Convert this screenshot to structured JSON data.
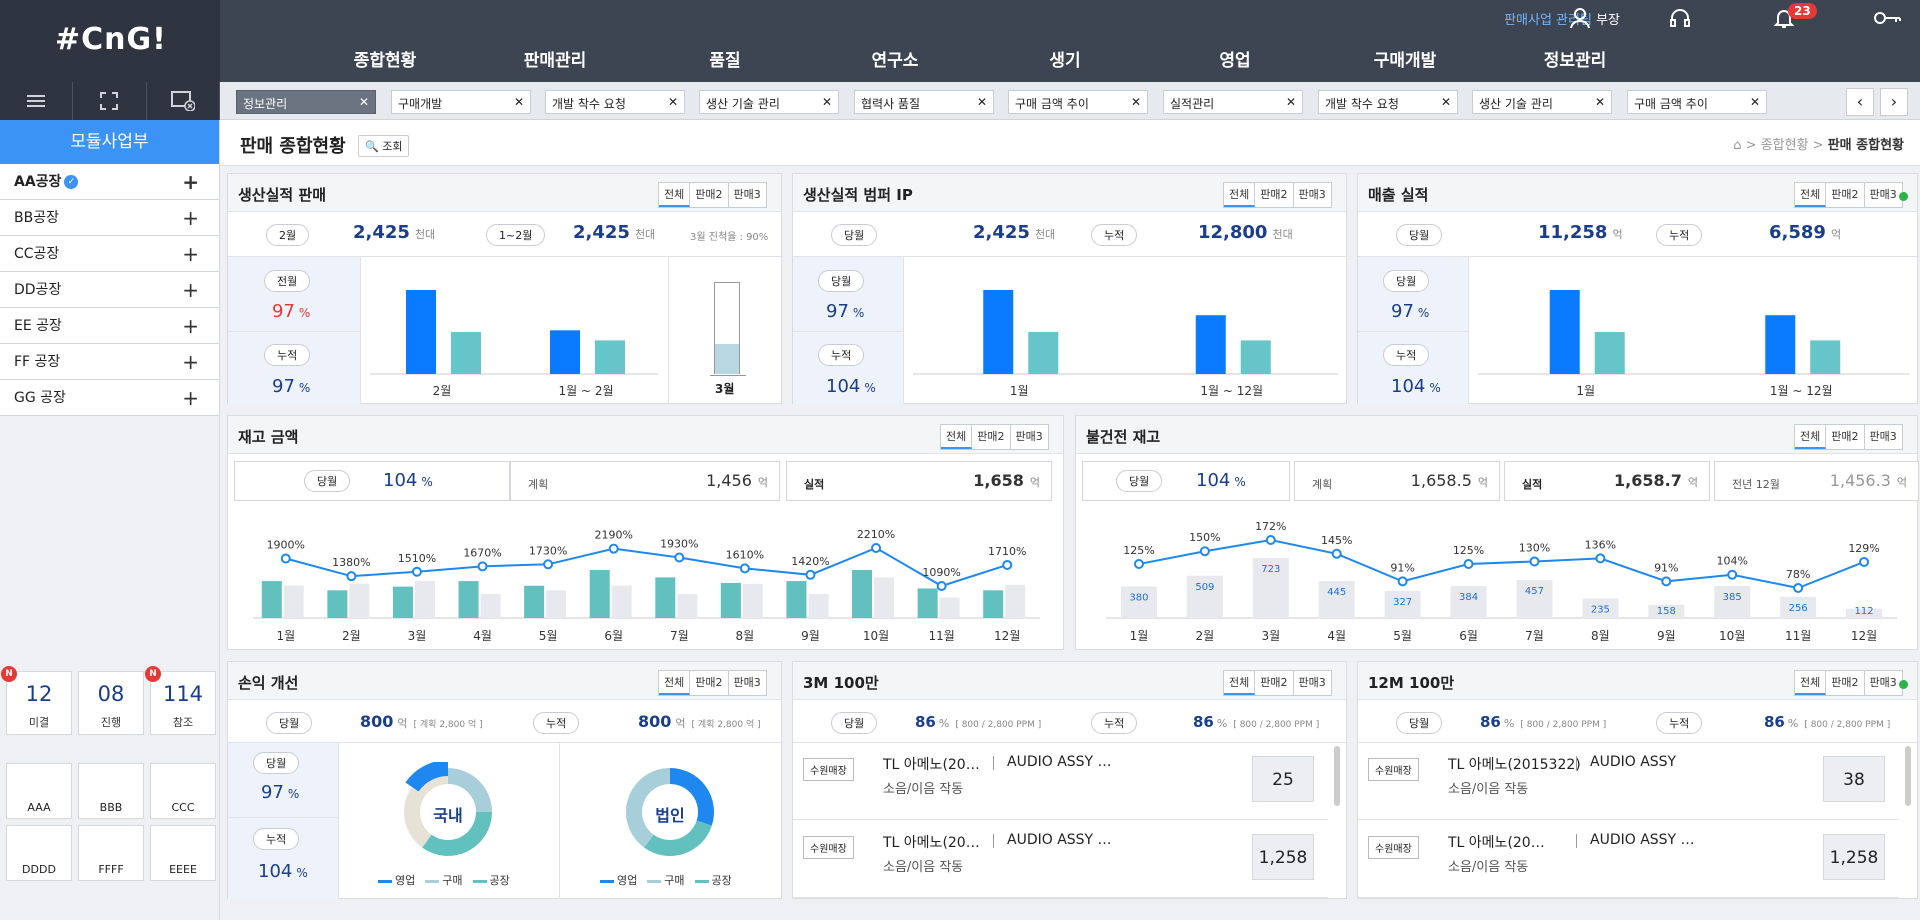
{
  "header": {
    "logo": "#CnG!",
    "user_dept": "판매사업 관리팀",
    "user_role": "부장",
    "notif_count": "23",
    "menu": [
      "종합현황",
      "판매관리",
      "품질",
      "연구소",
      "생기",
      "영업",
      "구매개발",
      "정보관리"
    ]
  },
  "tabs": [
    {
      "label": "정보관리",
      "active": true
    },
    {
      "label": "구매개발"
    },
    {
      "label": "개발 착수 요청"
    },
    {
      "label": "생산 기술 관리"
    },
    {
      "label": "협력사 품질"
    },
    {
      "label": "구매 금액 추이"
    },
    {
      "label": "실적관리"
    },
    {
      "label": "개발 착수 요청"
    },
    {
      "label": "생산 기술 관리"
    },
    {
      "label": "구매 금액 추이"
    }
  ],
  "sidebar": {
    "title": "모듈사업부",
    "plants": [
      "AA공장",
      "BB공장",
      "CC공장",
      "DD공장",
      "EE 공장",
      "FF 공장",
      "GG 공장"
    ],
    "stats": [
      {
        "num": "12",
        "label": "미결",
        "new": "N"
      },
      {
        "num": "08",
        "label": "진행"
      },
      {
        "num": "114",
        "label": "참조",
        "new": "N"
      }
    ],
    "apps": [
      {
        "label": "AAA",
        "icon": "laptop-icon"
      },
      {
        "label": "BBB",
        "icon": "cart-icon"
      },
      {
        "label": "CCC",
        "icon": "folder-icon"
      },
      {
        "label": "DDDD",
        "icon": "microscope-icon"
      },
      {
        "label": "FFFF",
        "icon": "chart-icon"
      },
      {
        "label": "EEEE",
        "icon": "edit-icon"
      }
    ]
  },
  "page": {
    "title": "판매 종합현황",
    "search": "조회",
    "bread_home": "종합현황",
    "bread_current": "판매 종합현황"
  },
  "seg": [
    "전체",
    "판매2",
    "판매3"
  ],
  "p1": {
    "title": "생산실적 판매",
    "pill1": "2월",
    "v1": "2,425",
    "u1": "천대",
    "pill2": "1~2월",
    "v2": "2,425",
    "u2": "천대",
    "note": "3월 진척율 : 90%",
    "lp1": "전월",
    "lv1": "97",
    "lp2": "누적",
    "lv2": "97",
    "pct": "%",
    "x1": "2월",
    "x2": "1월 ~ 2월",
    "x3": "3월"
  },
  "p2": {
    "title": "생산실적 범퍼 IP",
    "pill1": "당월",
    "v1": "2,425",
    "u1": "천대",
    "pill2": "누적",
    "v2": "12,800",
    "u2": "천대",
    "lp1": "당월",
    "lv1": "97",
    "lp2": "누적",
    "lv2": "104",
    "pct": "%",
    "x1": "1월",
    "x2": "1월 ~ 12월"
  },
  "p3": {
    "title": "매출 실적",
    "pill1": "당월",
    "v1": "11,258",
    "u1": "억",
    "pill2": "누적",
    "v2": "6,589",
    "u2": "억",
    "lp1": "당월",
    "lv1": "97",
    "lp2": "누적",
    "lv2": "104",
    "pct": "%",
    "x1": "1월",
    "x2": "1월 ~ 12월"
  },
  "p4": {
    "title": "재고 금액",
    "pill": "당월",
    "pv": "104",
    "pct": "%",
    "plan_l": "계획",
    "plan_v": "1,456",
    "perf_l": "실적",
    "perf_v": "1,658",
    "unit": "억"
  },
  "p5": {
    "title": "불건전 재고",
    "pill": "당월",
    "pv": "104",
    "pct": "%",
    "plan_l": "계획",
    "plan_v": "1,658.5",
    "perf_l": "실적",
    "perf_v": "1,658.7",
    "prev_l": "전년 12월",
    "prev_v": "1,456.3",
    "unit": "억"
  },
  "p6": {
    "title": "손익 개선",
    "pill1": "당월",
    "v1": "800",
    "u1": "억",
    "n1": "[ 계획 2,800 억 ]",
    "pill2": "누적",
    "v2": "800",
    "u2": "억",
    "n2": "[ 계획 2,800 억 ]",
    "lp1": "당월",
    "lv1": "97",
    "lp2": "누적",
    "lv2": "104",
    "pct": "%",
    "d1": "국내",
    "d2": "법인",
    "legend": [
      "영업",
      "구매",
      "공장"
    ]
  },
  "p7": {
    "title": "3M 100만",
    "pill1": "당월",
    "v1": "86",
    "pill2": "누적",
    "v2": "86",
    "pct": "%",
    "n": "[ 800 / 2,800 PPM ]",
    "cards": [
      {
        "tag": "수원매장",
        "name": "TL 아메노(20…",
        "part": "AUDIO ASSY …",
        "desc": "소음/이음 작동",
        "num": "25"
      },
      {
        "tag": "수원매장",
        "name": "TL 아메노(20…",
        "part": "AUDIO ASSY …",
        "desc": "소음/이음 작동",
        "num": "1,258"
      }
    ]
  },
  "p8": {
    "title": "12M 100만",
    "pill1": "당월",
    "v1": "86",
    "pill2": "누적",
    "v2": "86",
    "pct": "%",
    "n": "[ 800 / 2,800 PPM ]",
    "cards": [
      {
        "tag": "수원매장",
        "name": "TL 아메노(2015322)",
        "part": "AUDIO ASSY",
        "desc": "소음/이음 작동",
        "num": "38"
      },
      {
        "tag": "수원매장",
        "name": "TL 아메노(20…",
        "part": "AUDIO ASSY …",
        "desc": "소음/이음 작동",
        "num": "1,258"
      }
    ]
  },
  "chart_data": [
    {
      "type": "bar",
      "id": "p1",
      "categories": [
        "2월",
        "1월 ~ 2월"
      ],
      "series": [
        {
          "values": [
            100,
            52
          ]
        },
        {
          "values": [
            50,
            40
          ]
        }
      ],
      "colors": [
        "#0a7bff",
        "#66c5c8"
      ]
    },
    {
      "type": "bar",
      "id": "p2",
      "categories": [
        "1월",
        "1월 ~ 12월"
      ],
      "series": [
        {
          "values": [
            100,
            70
          ]
        },
        {
          "values": [
            50,
            40
          ]
        }
      ],
      "colors": [
        "#0a7bff",
        "#66c5c8"
      ]
    },
    {
      "type": "bar",
      "id": "p3",
      "categories": [
        "1월",
        "1월 ~ 12월"
      ],
      "series": [
        {
          "values": [
            100,
            70
          ]
        },
        {
          "values": [
            50,
            40
          ]
        }
      ],
      "colors": [
        "#0a7bff",
        "#66c5c8"
      ]
    },
    {
      "type": "line",
      "id": "p4",
      "categories": [
        "1월",
        "2월",
        "3월",
        "4월",
        "5월",
        "6월",
        "7월",
        "8월",
        "9월",
        "10월",
        "11월",
        "12월"
      ],
      "line_values": [
        1900,
        1380,
        1510,
        1670,
        1730,
        2190,
        1930,
        1610,
        1420,
        2210,
        1090,
        1710
      ],
      "line_labels": [
        "1900%",
        "1380%",
        "1510%",
        "1670%",
        "1730%",
        "2190%",
        "1930%",
        "1610%",
        "1420%",
        "2210%",
        "1090%",
        "1710%"
      ],
      "bar_a": [
        40,
        30,
        34,
        40,
        35,
        52,
        44,
        38,
        40,
        52,
        32,
        30
      ],
      "bar_b": [
        35,
        37,
        40,
        26,
        30,
        35,
        26,
        37,
        26,
        44,
        22,
        36
      ]
    },
    {
      "type": "line",
      "id": "p5",
      "categories": [
        "1월",
        "2월",
        "3월",
        "4월",
        "5월",
        "6월",
        "7월",
        "8월",
        "9월",
        "10월",
        "11월",
        "12월"
      ],
      "line_values": [
        125,
        150,
        172,
        145,
        91,
        125,
        130,
        136,
        91,
        104,
        78,
        129
      ],
      "line_labels": [
        "125%",
        "150%",
        "172%",
        "145%",
        "91%",
        "125%",
        "130%",
        "136%",
        "91%",
        "104%",
        "78%",
        "129%"
      ],
      "bar_values": [
        380,
        509,
        723,
        445,
        327,
        384,
        457,
        235,
        158,
        385,
        256,
        112
      ]
    },
    {
      "type": "pie",
      "id": "d1",
      "labels": [
        "영업",
        "구매",
        "공장"
      ],
      "values": [
        25,
        35,
        40
      ]
    },
    {
      "type": "pie",
      "id": "d2",
      "labels": [
        "영업",
        "구매",
        "공장"
      ],
      "values": [
        30,
        30,
        40
      ]
    }
  ]
}
